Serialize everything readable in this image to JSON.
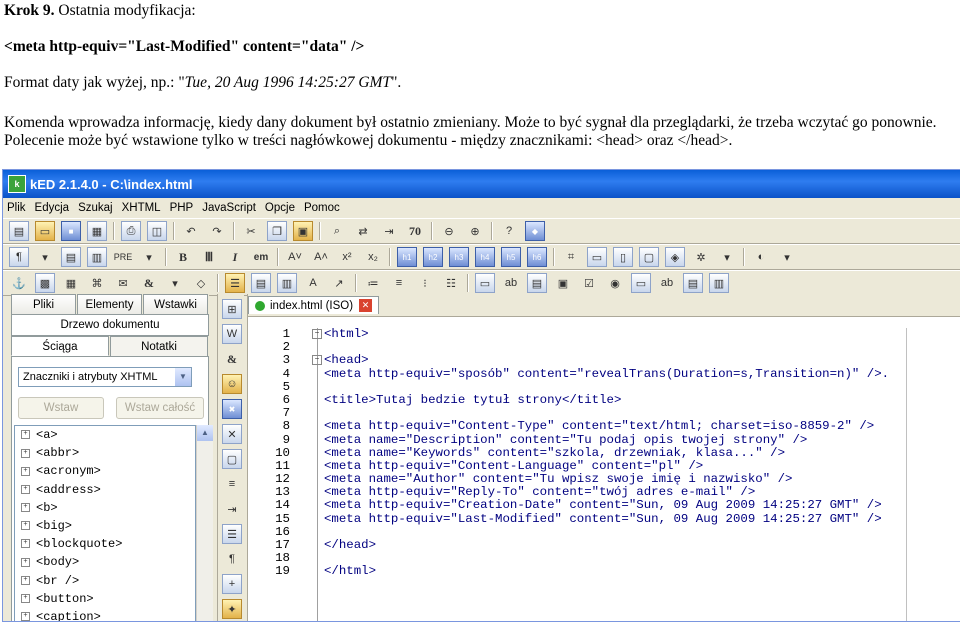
{
  "doc": {
    "step_label": "Krok 9.",
    "step_title": "Ostatnia modyfikacja:",
    "meta_tag": "<meta http-equiv=\"Last-Modified\" content=\"data\" />",
    "format_prefix": "Format daty jak wyżej, np.: \"",
    "format_example": "Tue, 20 Aug 1996 14:25:27 GMT",
    "format_suffix": "\".",
    "description": "Komenda wprowadza informację, kiedy dany dokument był ostatnio zmieniany. Może to być sygnał dla przeglądarki, że trzeba wczytać go ponownie. Polecenie może być wstawione tylko w treści nagłówkowej dokumentu - między znacznikami: <head> oraz </head>."
  },
  "window": {
    "title": "kED 2.1.4.0 - C:\\index.html",
    "menu": [
      "Plik",
      "Edycja",
      "Szukaj",
      "XHTML",
      "PHP",
      "JavaScript",
      "Opcje",
      "Pomoc"
    ]
  },
  "left_panel": {
    "tabs": [
      "Pliki",
      "Elementy",
      "Wstawki"
    ],
    "subtab": "Drzewo dokumentu",
    "tabs2": [
      "Ściąga",
      "Notatki"
    ],
    "select_value": "Znaczniki i atrybuty XHTML",
    "insert_button": "Wstaw",
    "insert_all_button": "Wstaw całość",
    "elements": [
      "<a>",
      "<abbr>",
      "<acronym>",
      "<address>",
      "<b>",
      "<big>",
      "<blockquote>",
      "<body>",
      "<br />",
      "<button>",
      "<caption>"
    ]
  },
  "editor": {
    "tab_label": "index.html (ISO)",
    "lines": [
      {
        "n": "1",
        "fold": "⊟",
        "code": "<html>"
      },
      {
        "n": "2",
        "fold": "",
        "code": ""
      },
      {
        "n": "3",
        "fold": "⊟",
        "code": "<head>"
      },
      {
        "n": "4",
        "fold": "",
        "code": "<meta http-equiv=\"sposób\" content=\"revealTrans(Duration=s,Transition=n)\" />."
      },
      {
        "n": "5",
        "fold": "",
        "code": ""
      },
      {
        "n": "6",
        "fold": "",
        "code": "<title>Tutaj bedzie tytuł strony</title>"
      },
      {
        "n": "7",
        "fold": "",
        "code": ""
      },
      {
        "n": "8",
        "fold": "",
        "code": "<meta http-equiv=\"Content-Type\" content=\"text/html; charset=iso-8859-2\" />"
      },
      {
        "n": "9",
        "fold": "",
        "code": "<meta name=\"Description\" content=\"Tu podaj opis twojej strony\" />"
      },
      {
        "n": "10",
        "fold": "",
        "code": "<meta name=\"Keywords\" content=\"szkola, drzewniak, klasa...\" />"
      },
      {
        "n": "11",
        "fold": "",
        "code": "<meta http-equiv=\"Content-Language\" content=\"pl\" />"
      },
      {
        "n": "12",
        "fold": "",
        "code": "<meta name=\"Author\" content=\"Tu wpisz swoje imię i nazwisko\" />"
      },
      {
        "n": "13",
        "fold": "",
        "code": "<meta http-equiv=\"Reply-To\" content=\"twój adres e-mail\" />"
      },
      {
        "n": "14",
        "fold": "",
        "code": "<meta http-equiv=\"Creation-Date\" content=\"Sun, 09 Aug 2009 14:25:27 GMT\" />"
      },
      {
        "n": "15",
        "fold": "",
        "code": "<meta http-equiv=\"Last-Modified\" content=\"Sun, 09 Aug 2009 14:25:27 GMT\" />"
      },
      {
        "n": "16",
        "fold": "",
        "code": ""
      },
      {
        "n": "17",
        "fold": "",
        "code": "</head>"
      },
      {
        "n": "18",
        "fold": "",
        "code": ""
      },
      {
        "n": "19",
        "fold": "",
        "code": "</html>"
      }
    ]
  },
  "toolbar_text": {
    "pre": "PRE",
    "em": "em",
    "h1": "h1",
    "h2": "h2",
    "h3": "h3",
    "h4": "h4",
    "h5": "h5",
    "h6": "h6",
    "num70": "70"
  }
}
